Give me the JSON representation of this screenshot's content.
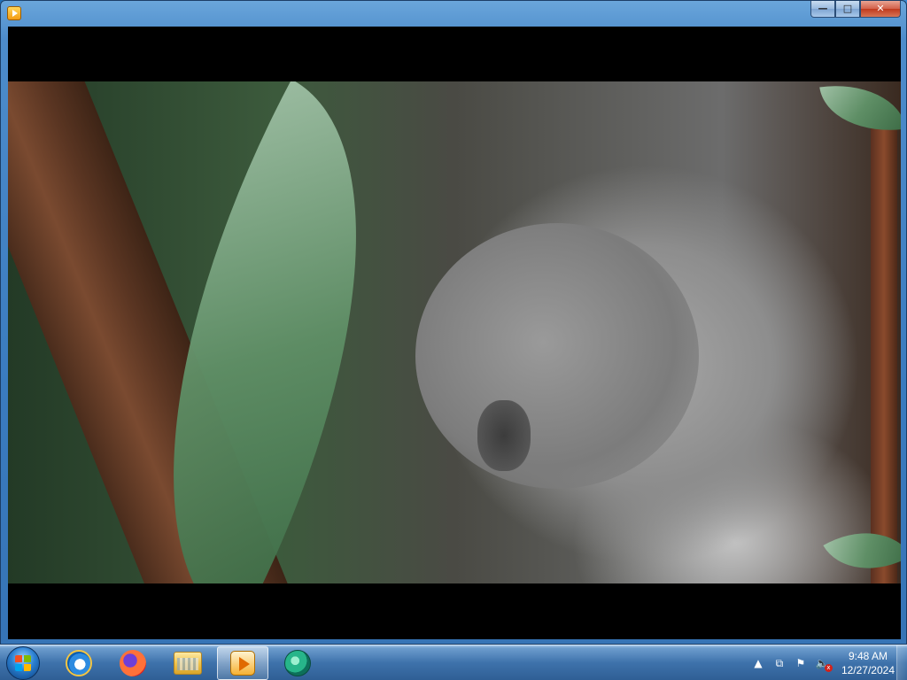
{
  "window": {
    "title": "",
    "controls": {
      "minimize": "—",
      "maximize": "□",
      "close": "✕"
    }
  },
  "taskbar": {
    "items": [
      {
        "name": "start-button",
        "icon": "windows-logo-icon"
      },
      {
        "name": "internet-explorer",
        "icon": "internet-explorer-icon"
      },
      {
        "name": "firefox",
        "icon": "firefox-icon"
      },
      {
        "name": "windows-explorer",
        "icon": "folder-icon"
      },
      {
        "name": "windows-media-player",
        "icon": "media-player-icon",
        "active": true
      },
      {
        "name": "windows-media-center",
        "icon": "media-center-icon"
      }
    ],
    "tray": {
      "expand": "▲",
      "network": "⧉",
      "flag": "⚑",
      "volume": "🔈",
      "volume_muted_badge": "x"
    },
    "clock": {
      "time": "9:48 AM",
      "date": "12/27/2024"
    }
  }
}
